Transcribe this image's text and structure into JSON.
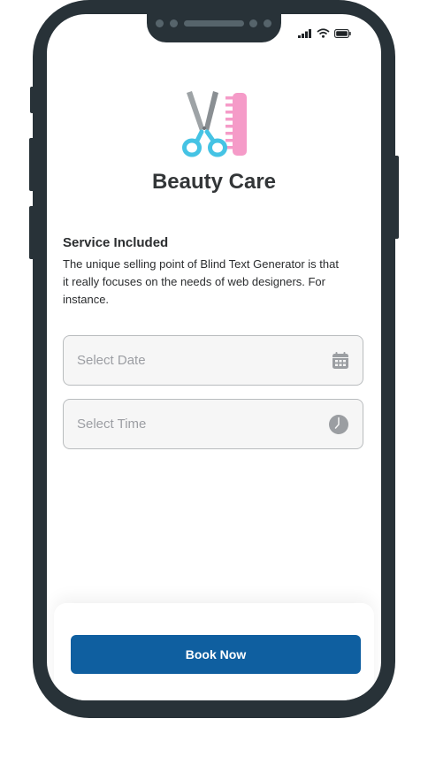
{
  "app": {
    "title": "Beauty Care",
    "logo_icon": "scissors-comb-icon"
  },
  "status_bar": {
    "icons": [
      "signal-icon",
      "wifi-icon",
      "battery-icon"
    ]
  },
  "service": {
    "heading": "Service Included",
    "description": "The unique selling point of Blind Text Generator is that it really focuses on the needs of web designers. For instance."
  },
  "form": {
    "date_placeholder": "Select Date",
    "date_icon": "calendar-icon",
    "time_placeholder": "Select Time",
    "time_icon": "clock-icon"
  },
  "actions": {
    "book_label": "Book Now"
  },
  "colors": {
    "primary": "#0f5fa0",
    "frame": "#283238",
    "scissor_blue": "#45c3e4",
    "comb_pink": "#f59bc8"
  }
}
